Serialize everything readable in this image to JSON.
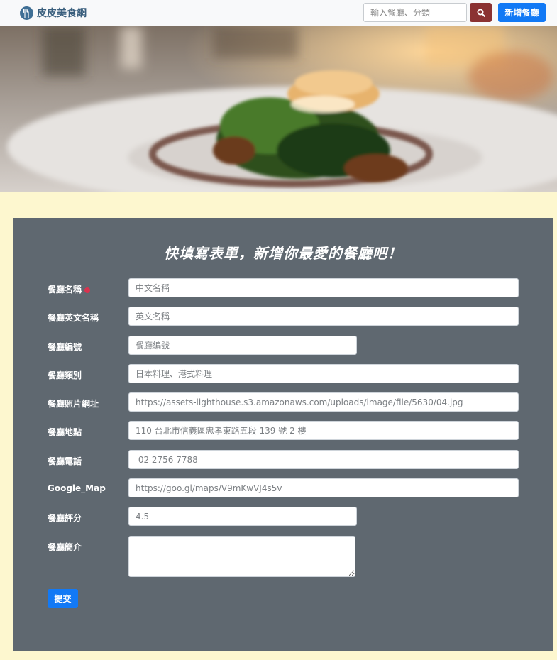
{
  "navbar": {
    "brand": "皮皮美食網",
    "search_placeholder": "輸入餐廳、分類",
    "add_button": "新增餐廳"
  },
  "form": {
    "title": "快填寫表單，新增你最愛的餐廳吧！",
    "fields": [
      {
        "label": "餐廳名稱",
        "placeholder": "中文名稱",
        "value": ""
      },
      {
        "label": "餐廳英文名稱",
        "placeholder": "英文名稱",
        "value": ""
      },
      {
        "label": "餐廳編號",
        "placeholder": "餐廳編號",
        "value": ""
      },
      {
        "label": "餐廳類別",
        "placeholder": "日本料理、港式料理",
        "value": ""
      },
      {
        "label": "餐廳照片網址",
        "placeholder": "https://assets-lighthouse.s3.amazonaws.com/uploads/image/file/5630/04.jpg",
        "value": ""
      },
      {
        "label": "餐廳地點",
        "placeholder": "110 台北市信義區忠孝東路五段 139 號 2 樓",
        "value": ""
      },
      {
        "label": "餐廳電話",
        "placeholder": " 02 2756 7788",
        "value": ""
      },
      {
        "label": "Google_Map",
        "placeholder": "https://goo.gl/maps/V9mKwVJ4s5v",
        "value": ""
      },
      {
        "label": "餐廳評分",
        "placeholder": "4.5",
        "value": ""
      },
      {
        "label": "餐廳簡介",
        "placeholder": "",
        "value": ""
      }
    ],
    "submit": "提交"
  },
  "colors": {
    "navbar_bg": "#f8f9fa",
    "search_button": "#8b3232",
    "primary_button": "#1279f5",
    "page_bg": "#fdf7cf",
    "form_bg": "#5f6870",
    "required_dot": "#d9334f"
  },
  "icons": {
    "brand": "utensils-icon",
    "search": "search-icon",
    "required": "required-dot-icon"
  }
}
